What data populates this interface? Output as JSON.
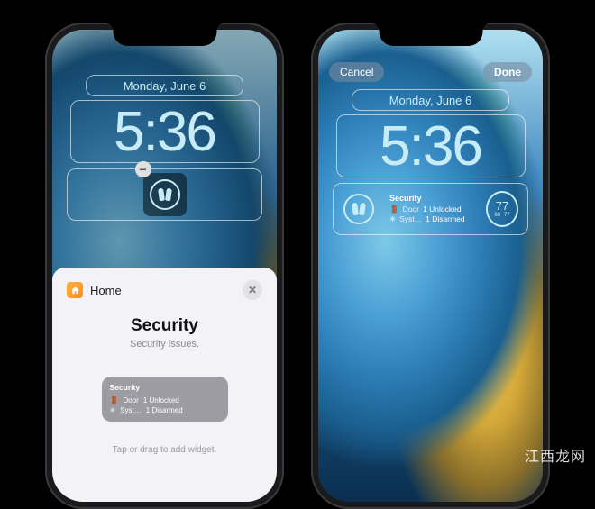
{
  "watermark": "江西龙网",
  "date": "Monday, June 6",
  "time": "5:36",
  "buttons": {
    "cancel": "Cancel",
    "done": "Done"
  },
  "sheet": {
    "app_name": "Home",
    "title": "Security",
    "subtitle": "Security issues.",
    "hint": "Tap or drag to add widget."
  },
  "security_widget": {
    "title": "Security",
    "rows": [
      {
        "icon": "🚪",
        "label": "Door",
        "status": "1 Unlocked"
      },
      {
        "icon": "✳",
        "label": "Syst…",
        "status": "1 Disarmed"
      }
    ]
  },
  "weather": {
    "temp": "77",
    "low": "60",
    "high": "77"
  }
}
